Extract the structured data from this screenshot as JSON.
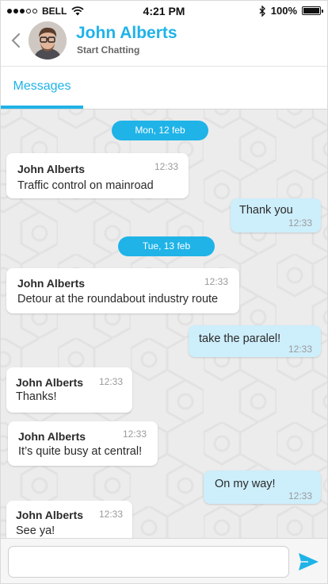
{
  "status_bar": {
    "carrier": "BELL",
    "time": "4:21 PM",
    "battery": "100%",
    "signal_bars_filled": 3,
    "signal_bars_total": 5
  },
  "header": {
    "contact_name": "John Alberts",
    "subtitle": "Start Chatting"
  },
  "tabs": [
    {
      "label": "Messages",
      "active": true
    }
  ],
  "dates": [
    {
      "label": "Mon, 12 feb"
    },
    {
      "label": "Tue, 13 feb"
    }
  ],
  "messages": [
    {
      "direction": "in",
      "sender": "John Alberts",
      "text": "Traffic control on mainroad",
      "time": "12:33"
    },
    {
      "direction": "out",
      "sender": "",
      "text": "Thank you",
      "time": "12:33"
    },
    {
      "direction": "in",
      "sender": "John Alberts",
      "text": "Detour at the roundabout industry route",
      "time": "12:33"
    },
    {
      "direction": "out",
      "sender": "",
      "text": "take the paralel!",
      "time": "12:33"
    },
    {
      "direction": "in",
      "sender": "John Alberts",
      "text": "Thanks!",
      "time": "12:33"
    },
    {
      "direction": "in",
      "sender": "John Alberts",
      "text": "It’s quite busy at central!",
      "time": "12:33"
    },
    {
      "direction": "out",
      "sender": "",
      "text": "On my way!",
      "time": "12:33"
    },
    {
      "direction": "in",
      "sender": "John Alberts",
      "text": "See ya!",
      "time": "12:33"
    }
  ],
  "composer": {
    "value": "",
    "placeholder": ""
  },
  "colors": {
    "accent": "#1fb3e8",
    "outgoing_bubble": "#cdeefb",
    "incoming_bubble": "#ffffff",
    "chat_background": "#ececec"
  }
}
